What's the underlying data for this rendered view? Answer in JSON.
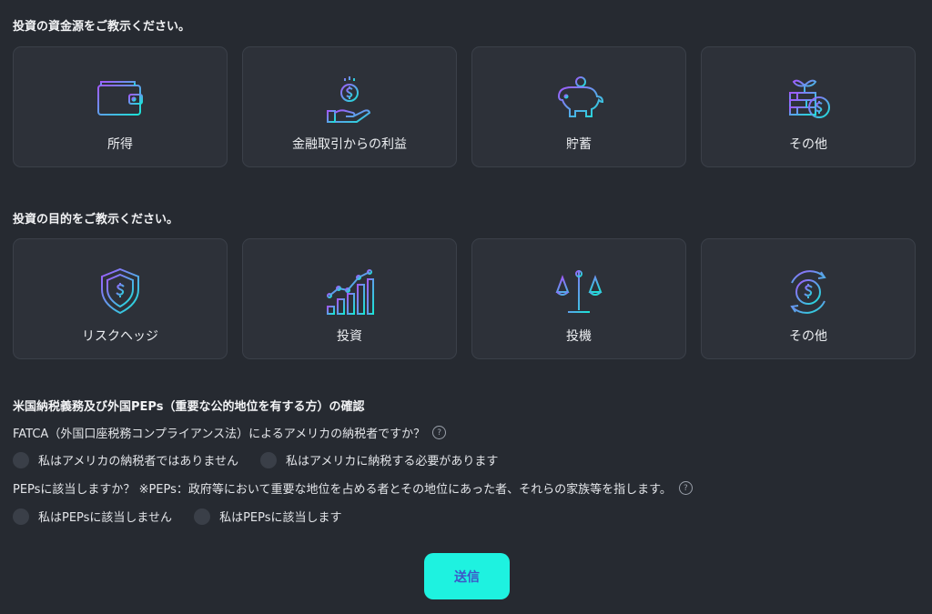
{
  "source_section": {
    "title": "投資の資金源をご教示ください。",
    "options": [
      {
        "label": "所得",
        "icon": "wallet-icon"
      },
      {
        "label": "金融取引からの利益",
        "icon": "hand-coin-icon"
      },
      {
        "label": "貯蓄",
        "icon": "piggy-bank-icon"
      },
      {
        "label": "その他",
        "icon": "plant-money-icon"
      }
    ]
  },
  "purpose_section": {
    "title": "投資の目的をご教示ください。",
    "options": [
      {
        "label": "リスクヘッジ",
        "icon": "shield-dollar-icon"
      },
      {
        "label": "投資",
        "icon": "growth-chart-icon"
      },
      {
        "label": "投機",
        "icon": "balance-scale-icon"
      },
      {
        "label": "その他",
        "icon": "dollar-cycle-icon"
      }
    ]
  },
  "confirmation": {
    "title": "米国納税義務及び外国PEPs（重要な公的地位を有する方）の確認",
    "fatca": {
      "question": "FATCA（外国口座税務コンプライアンス法）によるアメリカの納税者ですか？",
      "options": [
        "私はアメリカの納税者ではありません",
        "私はアメリカに納税する必要があります"
      ]
    },
    "peps": {
      "question": "PEPsに該当しますか？ ※PEPs：政府等において重要な地位を占める者とその地位にあった者、それらの家族等を指します。",
      "options": [
        "私はPEPsに該当しません",
        "私はPEPsに該当します"
      ]
    },
    "help_symbol": "?"
  },
  "submit_label": "送信",
  "colors": {
    "background": "#262a31",
    "card": "#2d3139",
    "accent_gradient_start": "#a259ff",
    "accent_gradient_end": "#19e6d6",
    "submit_bg": "#1ef2e0",
    "submit_text": "#3d56c8"
  }
}
